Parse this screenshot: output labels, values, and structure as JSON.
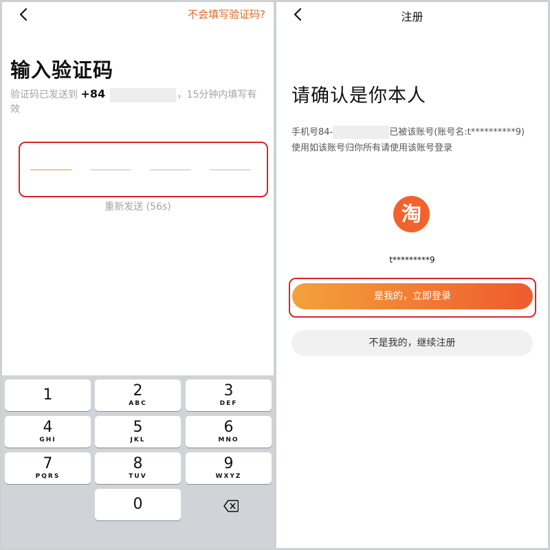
{
  "left_screen": {
    "help_link": "不会填写验证码?",
    "title": "输入验证码",
    "sent_prefix": "验证码已发送到",
    "country_code": "+84",
    "sent_suffix": "，15分钟内填写有效",
    "resend": "重新发送 (56s)",
    "keyboard": {
      "keys": [
        {
          "num": "1",
          "letters": ""
        },
        {
          "num": "2",
          "letters": "ABC"
        },
        {
          "num": "3",
          "letters": "DEF"
        },
        {
          "num": "4",
          "letters": "GHI"
        },
        {
          "num": "5",
          "letters": "JKL"
        },
        {
          "num": "6",
          "letters": "MNO"
        },
        {
          "num": "7",
          "letters": "PQRS"
        },
        {
          "num": "8",
          "letters": "TUV"
        },
        {
          "num": "9",
          "letters": "WXYZ"
        },
        {
          "num": "0",
          "letters": ""
        }
      ],
      "delete_icon": "backspace-icon"
    }
  },
  "right_screen": {
    "header_title": "注册",
    "title": "请确认是你本人",
    "info_prefix": "手机号84-",
    "info_suffix": "已被该账号(账号名:t**********9)",
    "info_line2": "使用如该账号归你所有请使用该账号登录",
    "logo_char": "淘",
    "account_name": "t*********9",
    "primary_button": "是我的，立即登录",
    "secondary_button": "不是我的，继续注册"
  },
  "colors": {
    "accent_orange": "#e2662a",
    "highlight_red": "#d8232a",
    "logo_orange": "#f2622c",
    "gradient_start": "#f3a13b",
    "gradient_end": "#ef5b2d"
  }
}
